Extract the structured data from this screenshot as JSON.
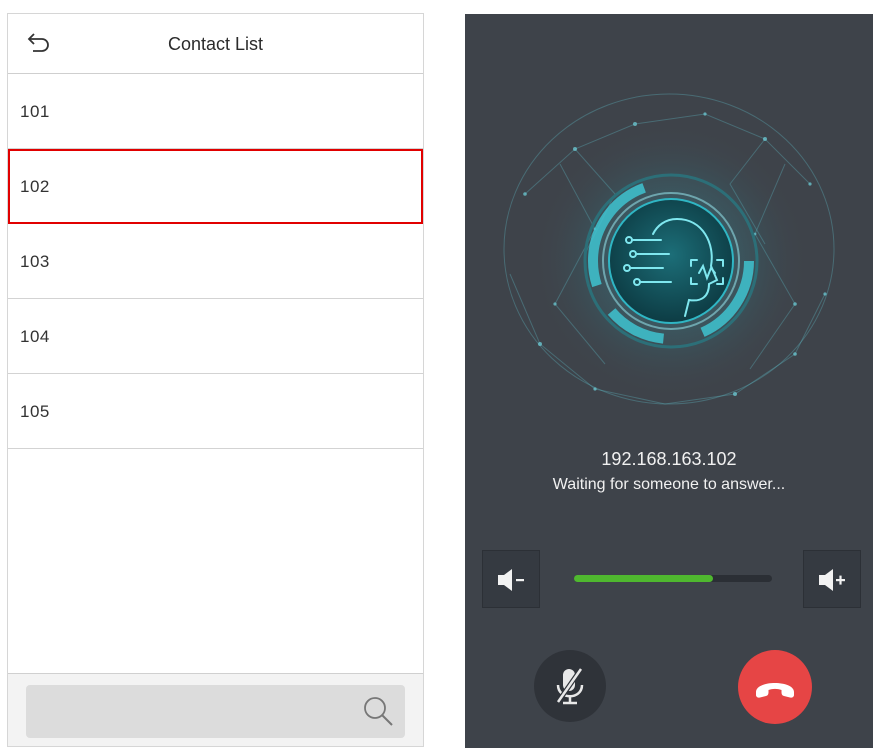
{
  "contact_list": {
    "title": "Contact List",
    "contacts": [
      "101",
      "102",
      "103",
      "104",
      "105"
    ],
    "selected": "102",
    "search_placeholder": ""
  },
  "call": {
    "ip": "192.168.163.102",
    "status": "Waiting for someone to answer...",
    "volume_fraction": 0.7
  },
  "colors": {
    "selection_border": "#e10000",
    "call_bg": "#3e434a",
    "volume_fill": "#4fb82f",
    "hangup": "#e64545",
    "accent_teal": "#2fb6c4"
  },
  "icons": {
    "back": "undo-arrow-icon",
    "search": "magnifier-icon",
    "volume_down": "speaker-minus-icon",
    "volume_up": "speaker-plus-icon",
    "mute": "mic-off-icon",
    "hangup": "phone-hangup-icon",
    "caller": "ai-face-icon"
  }
}
